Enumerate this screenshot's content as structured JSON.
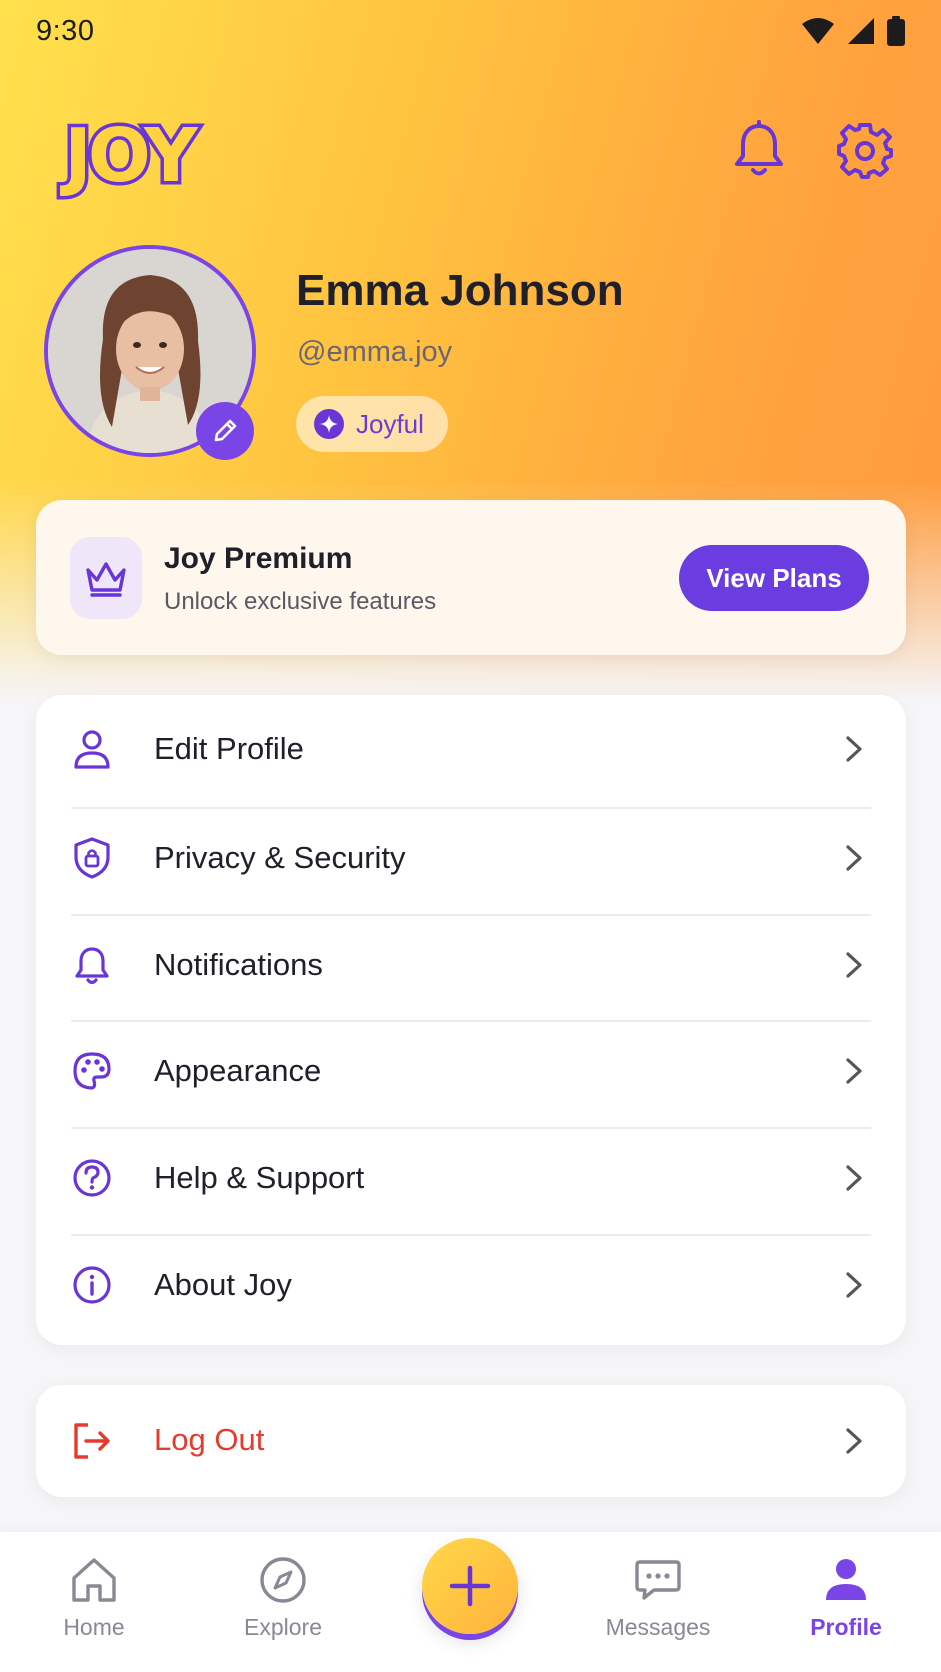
{
  "status_bar": {
    "time": "9:30",
    "icons": [
      "wifi-icon",
      "cellular-signal-icon",
      "battery-icon"
    ]
  },
  "header": {
    "logo_text": "JOY",
    "actions": [
      "bell-icon",
      "gear-icon"
    ]
  },
  "profile": {
    "name": "Emma Johnson",
    "handle": "@emma.joy",
    "mood": "Joyful",
    "mood_icon": "sparkle-icon",
    "edit_icon": "pencil-icon"
  },
  "premium": {
    "icon": "crown-icon",
    "title": "Joy Premium",
    "subtitle": "Unlock exclusive features",
    "button_label": "View Plans"
  },
  "menu": {
    "items": [
      {
        "label": "Edit Profile",
        "icon": "person-icon"
      },
      {
        "label": "Privacy & Security",
        "icon": "shield-lock-icon"
      },
      {
        "label": "Notifications",
        "icon": "bell-icon"
      },
      {
        "label": "Appearance",
        "icon": "palette-icon"
      },
      {
        "label": "Help & Support",
        "icon": "question-circle-icon"
      },
      {
        "label": "About Joy",
        "icon": "info-circle-icon"
      }
    ]
  },
  "logout": {
    "label": "Log Out",
    "icon": "logout-icon"
  },
  "bottom_nav": {
    "items": [
      {
        "label": "Home",
        "icon": "home-icon"
      },
      {
        "label": "Explore",
        "icon": "compass-icon"
      },
      {
        "label": "Messages",
        "icon": "chat-bubble-icon"
      },
      {
        "label": "Profile",
        "icon": "person-filled-icon",
        "active": true
      }
    ],
    "fab_icon": "plus-icon"
  },
  "colors": {
    "accent": "#7a45e6",
    "button": "#6b3ce0",
    "danger": "#e53b2c",
    "hero_start": "#ffe14d",
    "hero_end": "#ff9a3e"
  }
}
